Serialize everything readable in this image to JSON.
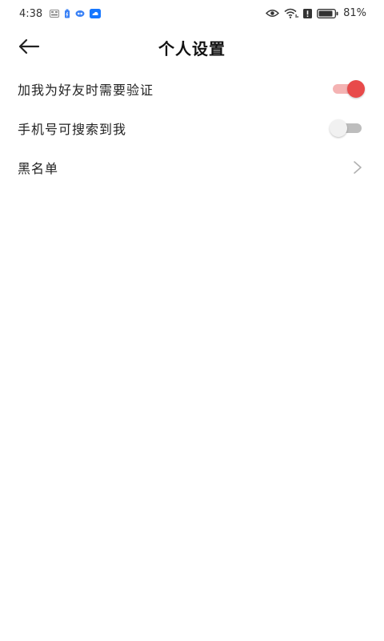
{
  "status_bar": {
    "time": "4:38",
    "battery_percent": "81%",
    "left_icons": [
      "gallery-icon",
      "battery-saver-icon",
      "cloud-sync-icon",
      "app-notification-icon"
    ],
    "right_icons": [
      "eye-icon",
      "wifi-icon",
      "alert-icon",
      "battery-icon"
    ]
  },
  "header": {
    "title": "个人设置",
    "back_icon": "back-arrow-icon"
  },
  "settings": [
    {
      "label": "加我为好友时需要验证",
      "control": "switch",
      "checked": true
    },
    {
      "label": "手机号可搜索到我",
      "control": "switch",
      "checked": false
    },
    {
      "label": "黑名单",
      "control": "chevron"
    }
  ],
  "colors": {
    "accent": "#e84a4a",
    "accent_track": "#f4b3b3",
    "switch_off_track": "#bdbdbd",
    "switch_off_thumb": "#f1f1f1",
    "text_primary": "#222222",
    "chevron": "#b0b0b0"
  }
}
